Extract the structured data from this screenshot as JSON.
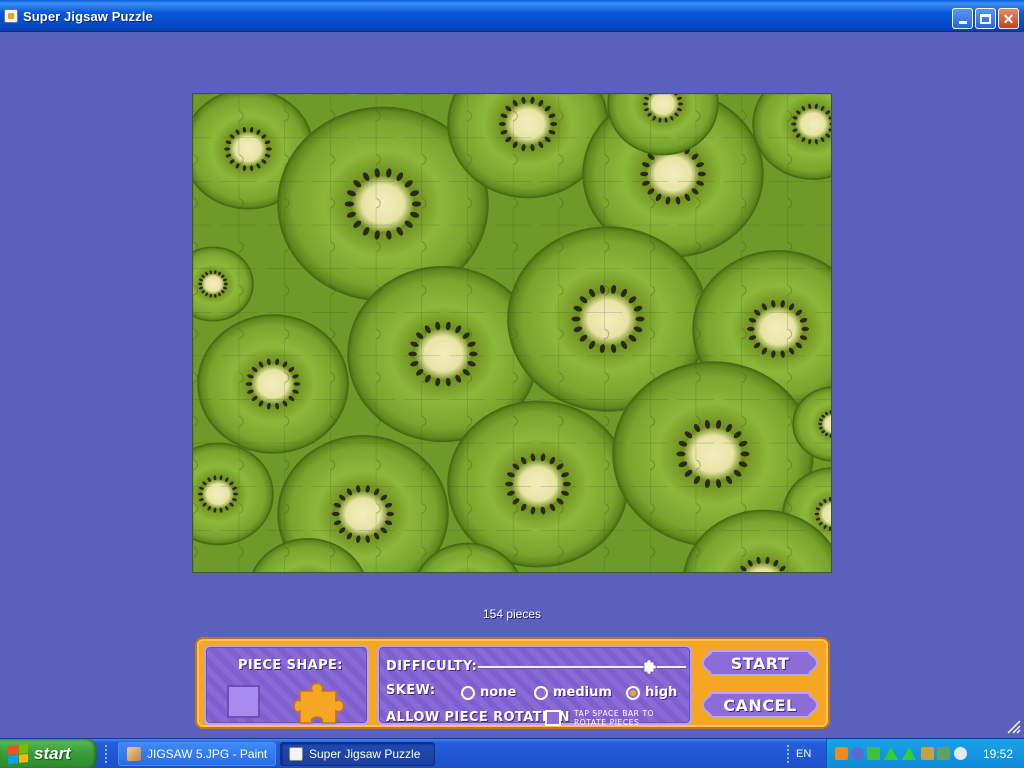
{
  "window": {
    "title": "Super Jigsaw Puzzle"
  },
  "puzzle": {
    "piece_count_text": "154 pieces"
  },
  "panel": {
    "piece_shape_label": "PIECE SHAPE:",
    "difficulty_label": "DIFFICULTY:",
    "difficulty_level": 0.82,
    "skew_label": "SKEW:",
    "skew_options": [
      "none",
      "medium",
      "high"
    ],
    "skew_selected": "high",
    "rotation_label": "ALLOW PIECE ROTATION",
    "rotation_checked": false,
    "rotation_hint": "TAP SPACE BAR TO ROTATE PIECES",
    "start_label": "START",
    "cancel_label": "CANCEL"
  },
  "taskbar": {
    "start_label": "start",
    "items": [
      {
        "label": "JIGSAW 5.JPG - Paint",
        "active": false
      },
      {
        "label": "Super Jigsaw Puzzle",
        "active": true
      }
    ],
    "language": "EN",
    "clock": "19:52"
  },
  "colors": {
    "background": "#5a60bc",
    "panel_orange": "#f5a623",
    "panel_purple": "#8c6dd8",
    "kiwi_green": "#7fae35"
  }
}
